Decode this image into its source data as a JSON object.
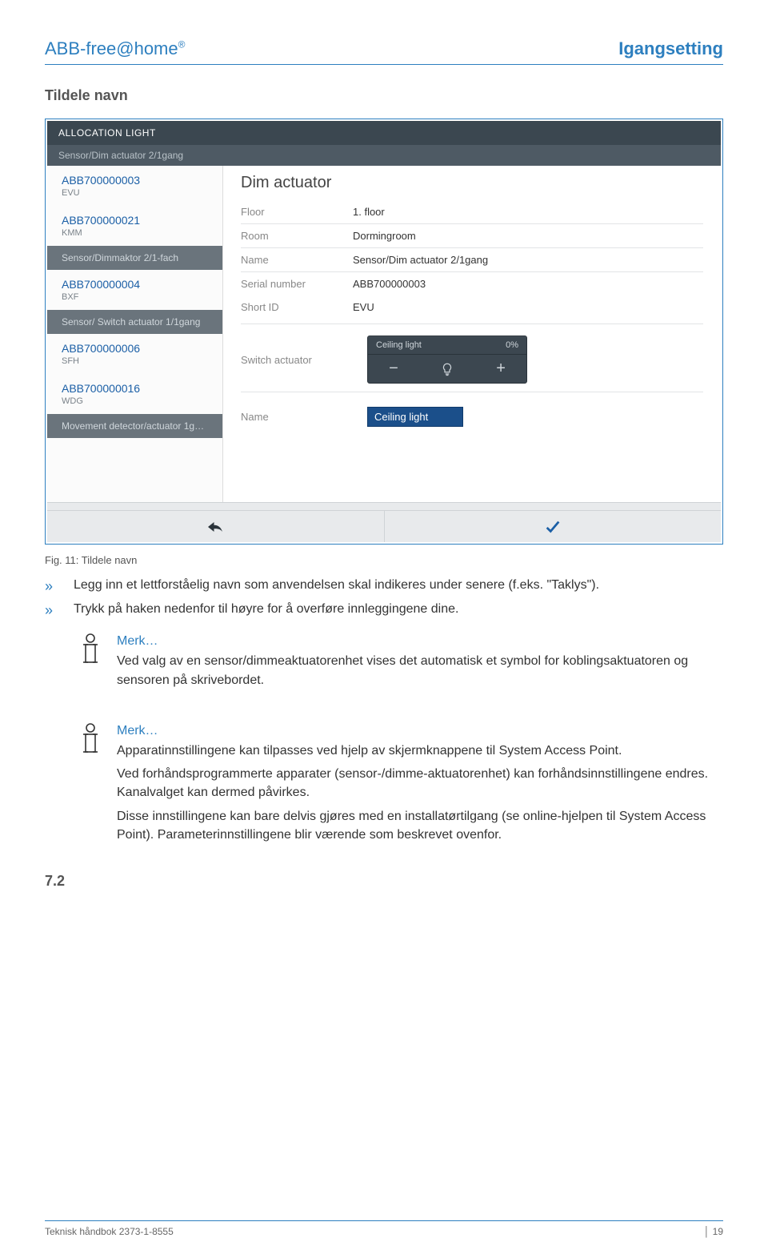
{
  "header": {
    "left": "ABB-free@home",
    "reg": "®",
    "right": "Igangsetting"
  },
  "section_title": "Tildele navn",
  "screenshot": {
    "topbar": "ALLOCATION LIGHT",
    "subbar": "Sensor/Dim actuator 2/1gang",
    "side": [
      {
        "id": "ABB700000003",
        "sub": "EVU",
        "type": "item"
      },
      {
        "id": "ABB700000021",
        "sub": "KMM",
        "type": "item"
      },
      {
        "label": "Sensor/Dimmaktor 2/1-fach",
        "type": "grey"
      },
      {
        "id": "ABB700000004",
        "sub": "BXF",
        "type": "item"
      },
      {
        "label": "Sensor/ Switch actuator 1/1gang",
        "type": "grey"
      },
      {
        "id": "ABB700000006",
        "sub": "SFH",
        "type": "item"
      },
      {
        "id": "ABB700000016",
        "sub": "WDG",
        "type": "item"
      },
      {
        "label": "Movement detector/actuator 1g…",
        "type": "grey"
      }
    ],
    "main_title": "Dim actuator",
    "details": [
      {
        "label": "Floor",
        "value": "1. floor"
      },
      {
        "label": "Room",
        "value": "Dormingroom"
      },
      {
        "label": "Name",
        "value": "Sensor/Dim actuator 2/1gang"
      },
      {
        "label": "Serial number",
        "value": "ABB700000003"
      },
      {
        "label": "Short ID",
        "value": "EVU"
      }
    ],
    "switch_label": "Switch actuator",
    "switch_widget": {
      "name": "Ceiling light",
      "pct": "0%"
    },
    "name_row": {
      "label": "Name",
      "input": "Ceiling light"
    }
  },
  "caption": "Fig. 11: Tildele navn",
  "bullets": [
    "Legg inn et lettforståelig navn som anvendelsen skal indikeres under senere (f.eks. \"Taklys\").",
    "Trykk på haken nedenfor til høyre for å overføre innleggingene dine."
  ],
  "bullet_mark": "»",
  "notes": [
    {
      "title": "Merk…",
      "paras": [
        "Ved valg av en sensor/dimmeaktuatorenhet vises det automatisk et symbol for koblingsaktuatoren og sensoren på skrivebordet."
      ]
    },
    {
      "title": "Merk…",
      "paras": [
        "Apparatinnstillingene kan tilpasses ved hjelp av skjermknappene til System Access Point.",
        "Ved forhåndsprogrammerte apparater (sensor-/dimme-aktuatorenhet) kan forhåndsinnstillingene endres. Kanalvalget kan dermed påvirkes.",
        "Disse innstillingene kan bare delvis gjøres med en installatørtilgang (se online-hjelpen til System Access Point). Parameterinnstillingene blir værende som beskrevet ovenfor."
      ]
    }
  ],
  "section_num": "7.2",
  "footer": {
    "left": "Teknisk håndbok 2373-1-8555",
    "right_sep": "│",
    "right_page": "19"
  }
}
